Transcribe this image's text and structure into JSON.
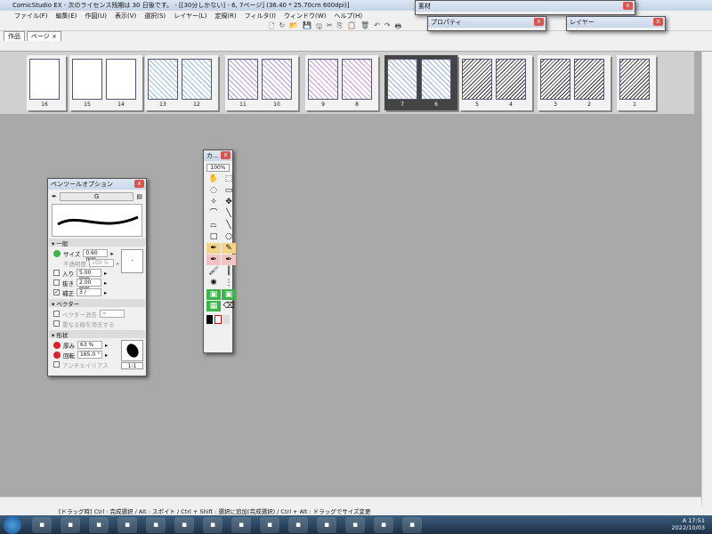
{
  "app": {
    "title": "ComicStudio EX - 次のライセンス残期は 30 日後です。 - [[30分しかない] - 6, 7ページ] (36.40 * 25.70cm 600dpi)]"
  },
  "menu": [
    "ファイル(F)",
    "編集(E)",
    "作図(U)",
    "表示(V)",
    "選択(S)",
    "レイヤー(L)",
    "定規(R)",
    "フィルタ(I)",
    "ウィンドウ(W)",
    "ヘルプ(H)"
  ],
  "toolbar_icons": [
    "new-icon",
    "open-icon",
    "folder-icon",
    "save-icon",
    "save-all-icon",
    "cut-icon",
    "copy-icon",
    "paste-icon",
    "delete-icon",
    "undo-icon",
    "redo-icon",
    "print-icon"
  ],
  "tabs": [
    {
      "label": "作品"
    },
    {
      "label": "ページ",
      "close": "×"
    }
  ],
  "spreads": [
    {
      "pages": [
        "16"
      ],
      "selected": false
    },
    {
      "pages": [
        "15",
        "14"
      ],
      "selected": false
    },
    {
      "pages": [
        "13",
        "12"
      ],
      "selected": false
    },
    {
      "pages": [
        "11",
        "10"
      ],
      "selected": false
    },
    {
      "pages": [
        "9",
        "8"
      ],
      "selected": false
    },
    {
      "pages": [
        "7",
        "6"
      ],
      "selected": true
    },
    {
      "pages": [
        "5",
        "4"
      ],
      "selected": false
    },
    {
      "pages": [
        "3",
        "2"
      ],
      "selected": false
    },
    {
      "pages": [
        "1"
      ],
      "selected": false
    }
  ],
  "palettes": {
    "material": "素材",
    "properties": "プロパティ",
    "layer": "レイヤー",
    "close": "x"
  },
  "pen_options": {
    "title": "ペンツールオプション",
    "preset": "G",
    "section_general": "一般",
    "size_label": "サイズ",
    "size": "0.60 mm",
    "opacity_label": "不透明度",
    "opacity": "100 %",
    "in_label": "入り",
    "in": "5.00 mm",
    "out_label": "抜き",
    "out": "2.00 mm",
    "correction_label": "補正",
    "correction": "3 /",
    "section_vector": "ベクター",
    "vector_erase_label": "ベクター消去",
    "vector_erase_value": "=",
    "overlap_label": "重なる線を消去する",
    "section_shape": "形状",
    "thickness_label": "厚み",
    "thickness": "63 %",
    "angle_label": "回転",
    "angle": "165.0 °",
    "antialias_label": "アンチエイリアス",
    "ratio": "1:1"
  },
  "tool_palette": {
    "title": "カ...",
    "zoom": "100%",
    "tools": [
      "hand",
      "select-rect",
      "lasso",
      "marquee",
      "magic-wand",
      "move",
      "curve",
      "line-curve",
      "polyline",
      "line",
      "rectangle",
      "ellipse",
      "pen",
      "pencil",
      "marker",
      "airbrush",
      "brush",
      "pattern",
      "blur",
      "dots",
      "fill",
      "gradient",
      "tone",
      "eraser"
    ]
  },
  "status": "[ドラッグ時] Ctrl : 完成選択 / Alt : スポイト / Ctrl + Shift : 選択に追加(完成選択) / Ctrl + Alt : ドラッグでサイズ変更",
  "taskbar": {
    "apps": [
      "media",
      "pen",
      "pse",
      "help",
      "book",
      "feather",
      "folder",
      "paint",
      "firefox",
      "app",
      "winamp",
      "chrome",
      "tablet",
      "image"
    ],
    "time": "17:51",
    "date": "2022/10/03",
    "lang": "A"
  },
  "colors": {
    "accent": "#3cb44b",
    "close": "#d9534f"
  }
}
